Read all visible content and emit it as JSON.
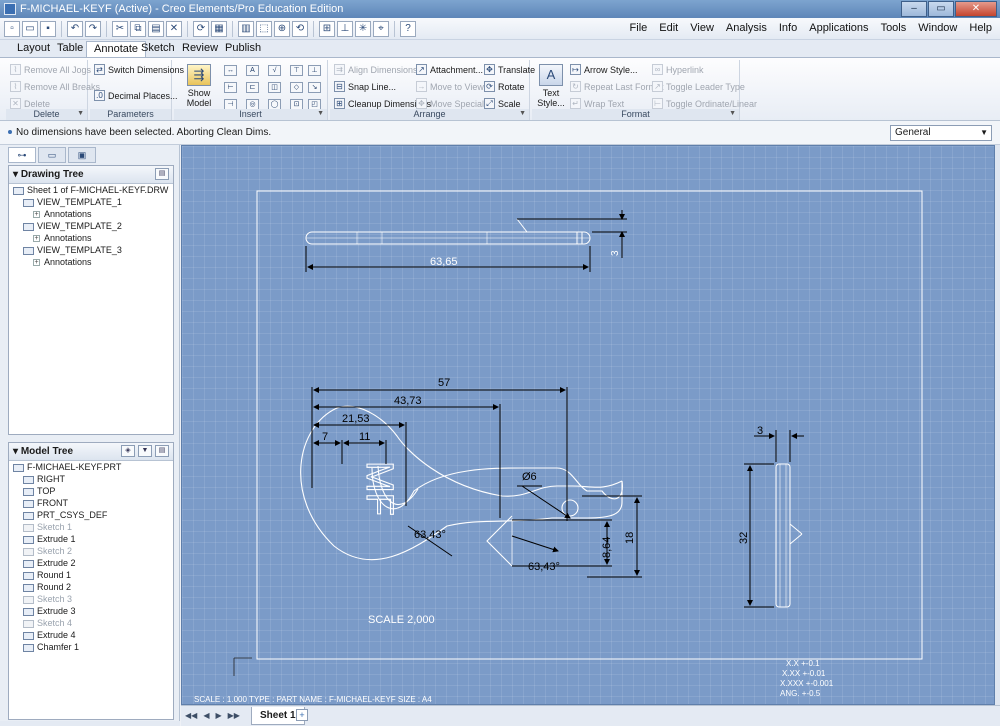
{
  "window": {
    "title": "F-MICHAEL-KEYF (Active) - Creo Elements/Pro Education Edition",
    "min_label": "–",
    "max_label": "▭",
    "close_label": "✕"
  },
  "menu": [
    "File",
    "Edit",
    "View",
    "Analysis",
    "Info",
    "Applications",
    "Tools",
    "Window",
    "Help"
  ],
  "tabs": [
    {
      "label": "Layout",
      "active": false
    },
    {
      "label": "Table",
      "active": false
    },
    {
      "label": "Annotate",
      "active": true
    },
    {
      "label": "Sketch",
      "active": false
    },
    {
      "label": "Review",
      "active": false
    },
    {
      "label": "Publish",
      "active": false
    }
  ],
  "ribbon": {
    "delete": {
      "label": "Delete",
      "items": [
        "Remove All Jogs",
        "Remove All Breaks",
        "Delete"
      ]
    },
    "parameters": {
      "label": "Parameters",
      "items": [
        "Switch Dimensions",
        "Decimal Places..."
      ]
    },
    "insert": {
      "label": "Insert",
      "show_model": "Show Model Annotations"
    },
    "arrange": {
      "label": "Arrange",
      "col1": [
        "Align Dimensions",
        "Snap Line...",
        "Cleanup Dimensions"
      ],
      "col2": [
        "Attachment...",
        "Move to View",
        "Move Special..."
      ],
      "col3": [
        "Translate",
        "Rotate",
        "Scale"
      ]
    },
    "format": {
      "label": "Format",
      "text_style": "Text Style...",
      "col1": [
        "Arrow Style...",
        "Repeat Last Format",
        "Wrap Text"
      ],
      "col2": [
        "Hyperlink",
        "Toggle Leader Type",
        "Toggle Ordinate/Linear"
      ]
    }
  },
  "message": "No dimensions have been selected.  Aborting Clean Dims.",
  "filter_select": "General",
  "drawing_tree": {
    "title": "Drawing Tree",
    "rows": [
      {
        "label": "Sheet 1 of F-MICHAEL-KEYF.DRW",
        "indent": 0,
        "grey": false
      },
      {
        "label": "VIEW_TEMPLATE_1",
        "indent": 1,
        "grey": false
      },
      {
        "label": "Annotations",
        "indent": 2,
        "grey": false
      },
      {
        "label": "VIEW_TEMPLATE_2",
        "indent": 1,
        "grey": false
      },
      {
        "label": "Annotations",
        "indent": 2,
        "grey": false
      },
      {
        "label": "VIEW_TEMPLATE_3",
        "indent": 1,
        "grey": false
      },
      {
        "label": "Annotations",
        "indent": 2,
        "grey": false
      }
    ]
  },
  "model_tree": {
    "title": "Model Tree",
    "rows": [
      {
        "label": "F-MICHAEL-KEYF.PRT",
        "indent": 0,
        "grey": false
      },
      {
        "label": "RIGHT",
        "indent": 1,
        "grey": false
      },
      {
        "label": "TOP",
        "indent": 1,
        "grey": false
      },
      {
        "label": "FRONT",
        "indent": 1,
        "grey": false
      },
      {
        "label": "PRT_CSYS_DEF",
        "indent": 1,
        "grey": false
      },
      {
        "label": "Sketch 1",
        "indent": 1,
        "grey": true
      },
      {
        "label": "Extrude 1",
        "indent": 1,
        "grey": false
      },
      {
        "label": "Sketch 2",
        "indent": 1,
        "grey": true
      },
      {
        "label": "Extrude 2",
        "indent": 1,
        "grey": false
      },
      {
        "label": "Round 1",
        "indent": 1,
        "grey": false
      },
      {
        "label": "Round 2",
        "indent": 1,
        "grey": false
      },
      {
        "label": "Sketch 3",
        "indent": 1,
        "grey": true
      },
      {
        "label": "Extrude 3",
        "indent": 1,
        "grey": false
      },
      {
        "label": "Sketch 4",
        "indent": 1,
        "grey": true
      },
      {
        "label": "Extrude 4",
        "indent": 1,
        "grey": false
      },
      {
        "label": "Chamfer 1",
        "indent": 1,
        "grey": false
      }
    ]
  },
  "drawing": {
    "dims": {
      "top_length": "63,65",
      "top_thickness": "3",
      "d57": "57",
      "d4373": "43,73",
      "d2153": "21,53",
      "d7": "7",
      "d11": "11",
      "hole": "Ø6",
      "angle1": "63,43°",
      "angle2": "63,43°",
      "d864": "8,64",
      "d18": "18",
      "side_thickness": "3",
      "side_height": "32"
    },
    "scale_note": "SCALE  2,000",
    "tolerances": [
      "X.X   +-0.1",
      "X.XX   +-0.01",
      "X.XXX  +-0.001",
      "ANG.  +-0.5"
    ],
    "footer": "SCALE : 1.000     TYPE : PART     NAME : F-MICHAEL-KEYF     SIZE : A4"
  },
  "sheet_tab": "Sheet 1",
  "colors": {
    "canvas": "#7b9bc8",
    "geometry": "#ffffff",
    "dimension": "#000000",
    "border": "#ffffff"
  }
}
